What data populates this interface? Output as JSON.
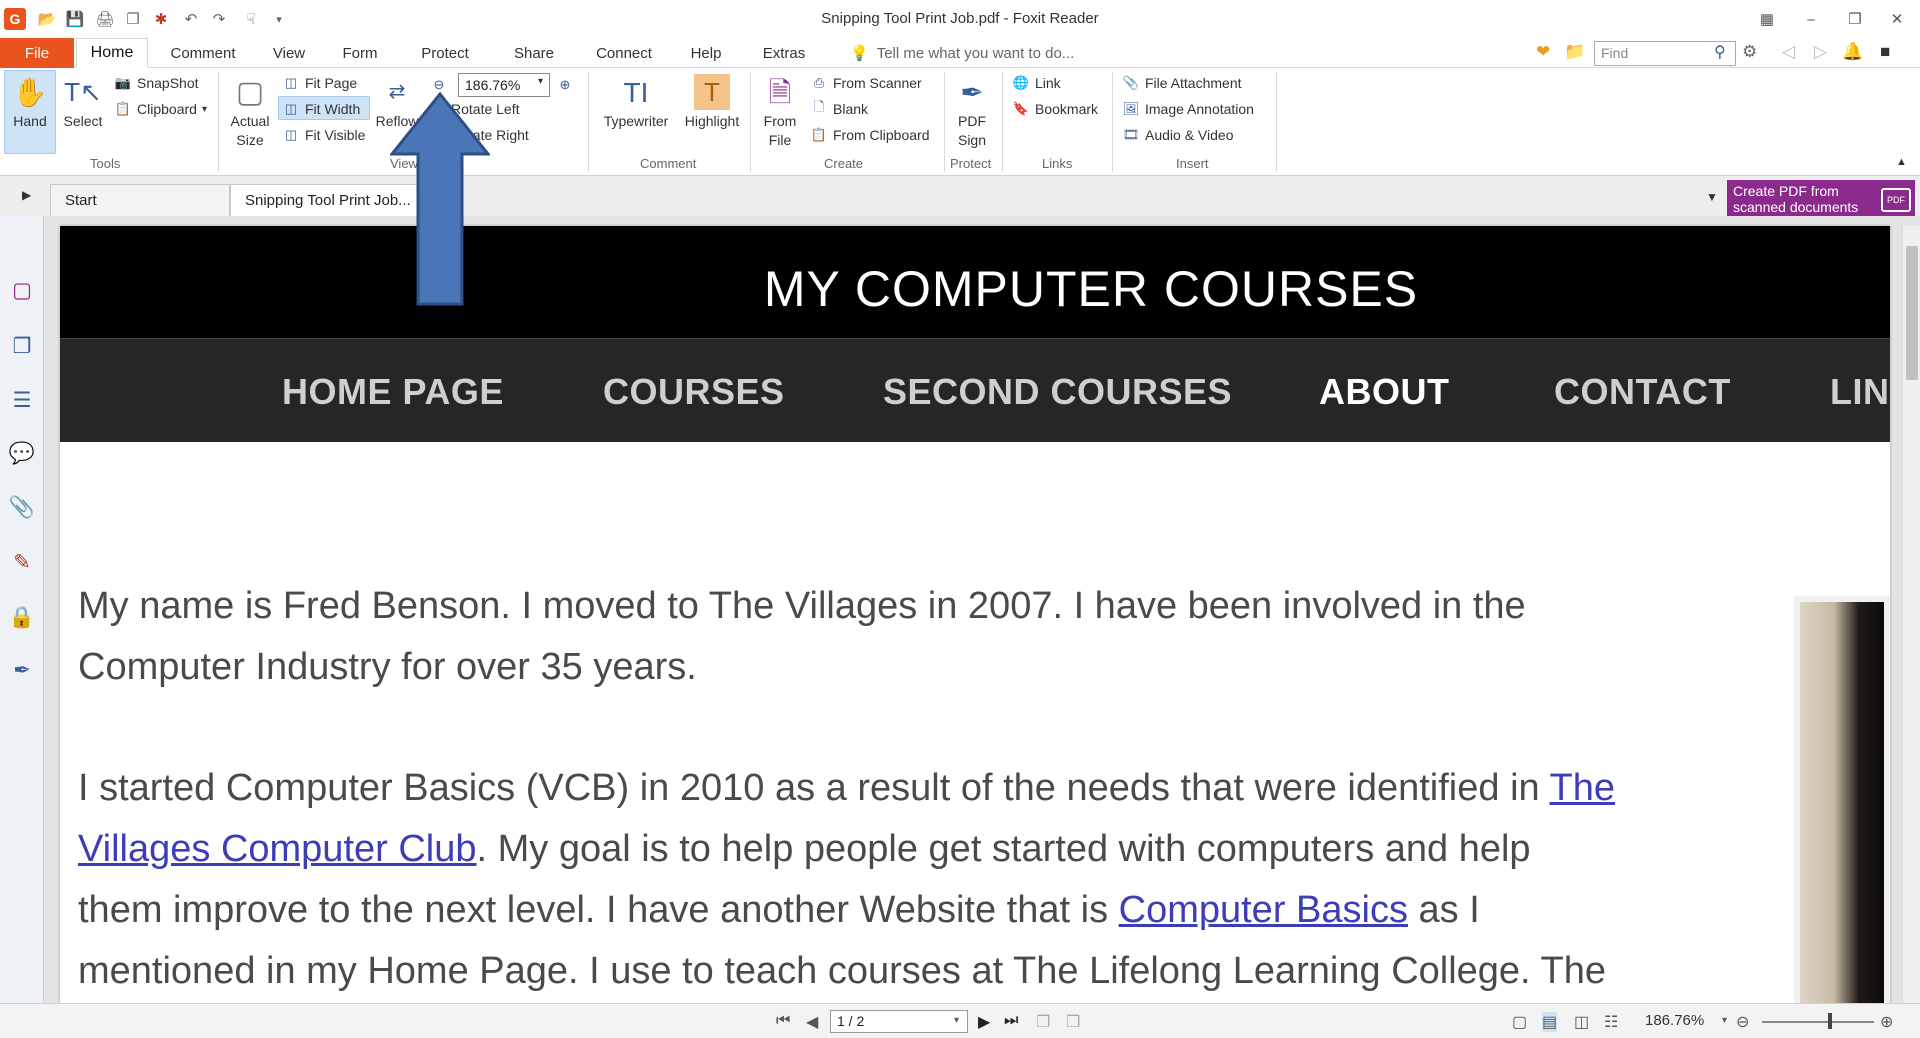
{
  "titlebar": {
    "title": "Snipping Tool Print Job.pdf - Foxit Reader",
    "find_placeholder": "Find"
  },
  "menu": {
    "file": "File",
    "tabs": [
      "Home",
      "Comment",
      "View",
      "Form",
      "Protect",
      "Share",
      "Connect",
      "Help",
      "Extras"
    ],
    "active_tab": "Home",
    "tell_me": "Tell me what you want to do..."
  },
  "ribbon": {
    "tools": {
      "hand": "Hand",
      "select": "Select",
      "snapshot": "SnapShot",
      "clipboard": "Clipboard",
      "group": "Tools"
    },
    "view": {
      "actual_size_1": "Actual",
      "actual_size_2": "Size",
      "fit_page": "Fit Page",
      "fit_width": "Fit Width",
      "fit_visible": "Fit Visible",
      "reflow": "Reflow",
      "zoom": "186.76%",
      "rotate_left": "Rotate Left",
      "rotate_right": "Rotate Right",
      "group": "View"
    },
    "comment": {
      "typewriter": "Typewriter",
      "highlight": "Highlight",
      "group": "Comment"
    },
    "create": {
      "from_file_1": "From",
      "from_file_2": "File",
      "from_scanner": "From Scanner",
      "blank": "Blank",
      "from_clipboard": "From Clipboard",
      "group": "Create"
    },
    "protect": {
      "pdf_sign_1": "PDF",
      "pdf_sign_2": "Sign",
      "group": "Protect"
    },
    "links": {
      "link": "Link",
      "bookmark": "Bookmark",
      "group": "Links"
    },
    "insert": {
      "file_attachment": "File Attachment",
      "image_annotation": "Image Annotation",
      "audio_video": "Audio & Video",
      "group": "Insert"
    }
  },
  "doc_tabs": [
    "Start",
    "Snipping Tool Print Job..."
  ],
  "promo": {
    "line1": "Create PDF from",
    "line2": "scanned documents",
    "icon": "PDF"
  },
  "page": {
    "site_title": "MY COMPUTER COURSES",
    "nav": [
      "HOME PAGE",
      "COURSES",
      "SECOND COURSES",
      "ABOUT",
      "CONTACT",
      "LIN"
    ],
    "active_nav": "ABOUT",
    "para1_line1": "My name is Fred Benson.  I moved to The Villages in 2007.  I have been involved in the",
    "para1_line2": "Computer Industry for over 35 years.",
    "para2_line1_a": "I started Computer Basics (VCB) in 2010 as a result of the needs that were identified in ",
    "para2_line1_link": "The",
    "para2_line2_link": "Villages Computer Club",
    "para2_line2_b": ".  My goal is to help people get started with computers and help",
    "para2_line3_a": "them improve to the next level.  I have another Website that is ",
    "para2_line3_link": "Computer Basics",
    "para2_line3_b": " as I",
    "para2_line4": "mentioned in my Home Page.  I use to teach courses at The Lifelong Learning College.  The"
  },
  "status": {
    "page": "1 / 2",
    "zoom": "186.76%"
  },
  "colors": {
    "accent": "#e8541b",
    "arrow": "#4a76b8",
    "promo": "#8b2a8c",
    "link": "#3d3db8"
  }
}
